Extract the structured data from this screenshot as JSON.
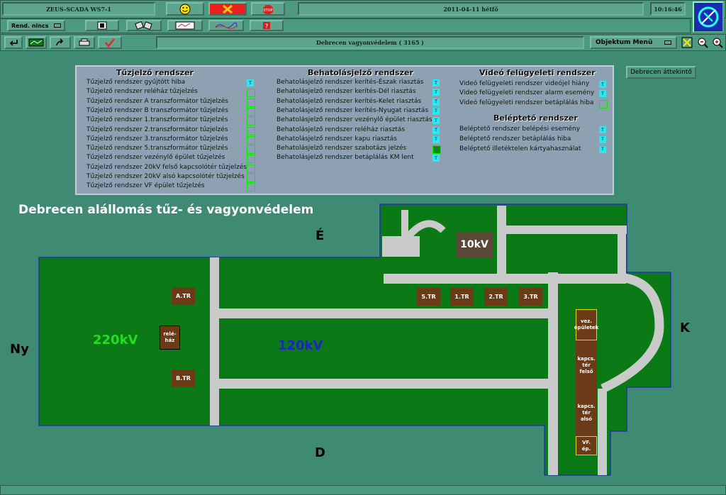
{
  "title_bar": {
    "app_name": "ZEUS-SCADA WS7-1",
    "date": "2011-04-11  hétfő",
    "time": "10:16:46"
  },
  "toolbar2": {
    "rend_label": "Rend. nincs"
  },
  "toolbar3": {
    "page_title": "Debrecen vagyonvédelem ( 3165 )",
    "object_menu": "Objektum Menü"
  },
  "side_button": "Debrecen áttekintő",
  "legend": {
    "fire": {
      "heading": "Tűzjelző rendszer",
      "items": [
        {
          "label": "Tűzjelző rendszer gyűjtött hiba",
          "state": "cyan"
        },
        {
          "label": "Tűzjelző rendszer reléház tűzjelzés",
          "state": "hollow"
        },
        {
          "label": "Tűzjelző rendszer A transzformátor tűzjelzés",
          "state": "hollow"
        },
        {
          "label": "Tűzjelző rendszer B transzformátor tűzjelzés",
          "state": "hollow"
        },
        {
          "label": "Tűzjelző rendszer 1.transzformátor tűzjelzés",
          "state": "hollow"
        },
        {
          "label": "Tűzjelző rendszer 2.transzformátor tűzjelzés",
          "state": "hollow"
        },
        {
          "label": "Tűzjelző rendszer 3.transzformátor tűzjelzés",
          "state": "hollow"
        },
        {
          "label": "Tűzjelző rendszer 5.transzformátor tűzjelzés",
          "state": "hollow"
        },
        {
          "label": "Tűzjelző rendszer vezénylő épület tűzjelzés",
          "state": "hollow"
        },
        {
          "label": "Tűzjelző rendszer 20kV felső kapcsolótér tűzjelzés",
          "state": "hollow"
        },
        {
          "label": "Tűzjelző rendszer 20kV alsó kapcsolótér tűzjelzés",
          "state": "hollow"
        },
        {
          "label": "Tűzjelző rendszer VF épület tűzjelzés",
          "state": "hollow"
        }
      ]
    },
    "intrusion": {
      "heading": "Behatolásjelző rendszer",
      "items": [
        {
          "label": "Behatolásjelző rendszer kerítés-Észak riasztás",
          "state": "cyan"
        },
        {
          "label": "Behatolásjelző rendszer kerítés-Dél riasztás",
          "state": "cyan"
        },
        {
          "label": "Behatolásjelző rendszer kerítés-Kelet riasztás",
          "state": "cyan"
        },
        {
          "label": "Behatolásjelző rendszer kerítés-Nyugat riasztás",
          "state": "cyan"
        },
        {
          "label": "Behatolásjelző rendszer vezénylő épület riasztás",
          "state": "cyan"
        },
        {
          "label": "Behatolásjelző rendszer reléház riasztás",
          "state": "cyan"
        },
        {
          "label": "Behatolásjelző rendszer kapu riasztás",
          "state": "cyan"
        },
        {
          "label": "Behatolásjelző rendszer szabotázs jelzés",
          "state": "green"
        },
        {
          "label": "Behatolásjelző rendszer betáplálás KM lent",
          "state": "cyan"
        }
      ]
    },
    "video": {
      "heading": "Videó felügyeleti rendszer",
      "items": [
        {
          "label": "Videó felügyeleti rendszer videójel hiány",
          "state": "cyan"
        },
        {
          "label": "Videó felügyeleti rendszer alarm esemény",
          "state": "cyan"
        },
        {
          "label": "Videó felügyeleti rendszer betáplálás hiba",
          "state": "hollow"
        }
      ]
    },
    "access": {
      "heading": "Beléptető rendszer",
      "items": [
        {
          "label": "Beléptető rendszer belépési esemény",
          "state": "cyan"
        },
        {
          "label": "Beléptető rendszer betáplálás hiba",
          "state": "cyan"
        },
        {
          "label": "Beléptető illetéktelen kártyahasználat",
          "state": "cyan"
        }
      ]
    },
    "indicator_glyph": "T"
  },
  "map": {
    "title": "Debrecen alállomás tűz- és vagyonvédelem",
    "north": "É",
    "south": "D",
    "east": "K",
    "west": "Ny",
    "labels": {
      "kv220": "220kV",
      "kv120": "120kV",
      "kv10": "10kV"
    },
    "buildings": {
      "atr": "A.TR",
      "btr": "B.TR",
      "rele": "relé-\nház",
      "tr5": "5.TR",
      "tr1": "1.TR",
      "tr2": "2.TR",
      "tr3": "3.TR",
      "vez": "vez.\népületek",
      "kapcs_felso": "kapcs.\ntér\nfelső",
      "kapcs_also": "kapcs.\ntér\nalsó",
      "vf": "VF.\nép."
    },
    "colors": {
      "ground": "#0b7a16",
      "road": "#cacaca",
      "building": "#6b3a16",
      "kv220": "#22dd22",
      "kv120": "#2222cc"
    }
  }
}
